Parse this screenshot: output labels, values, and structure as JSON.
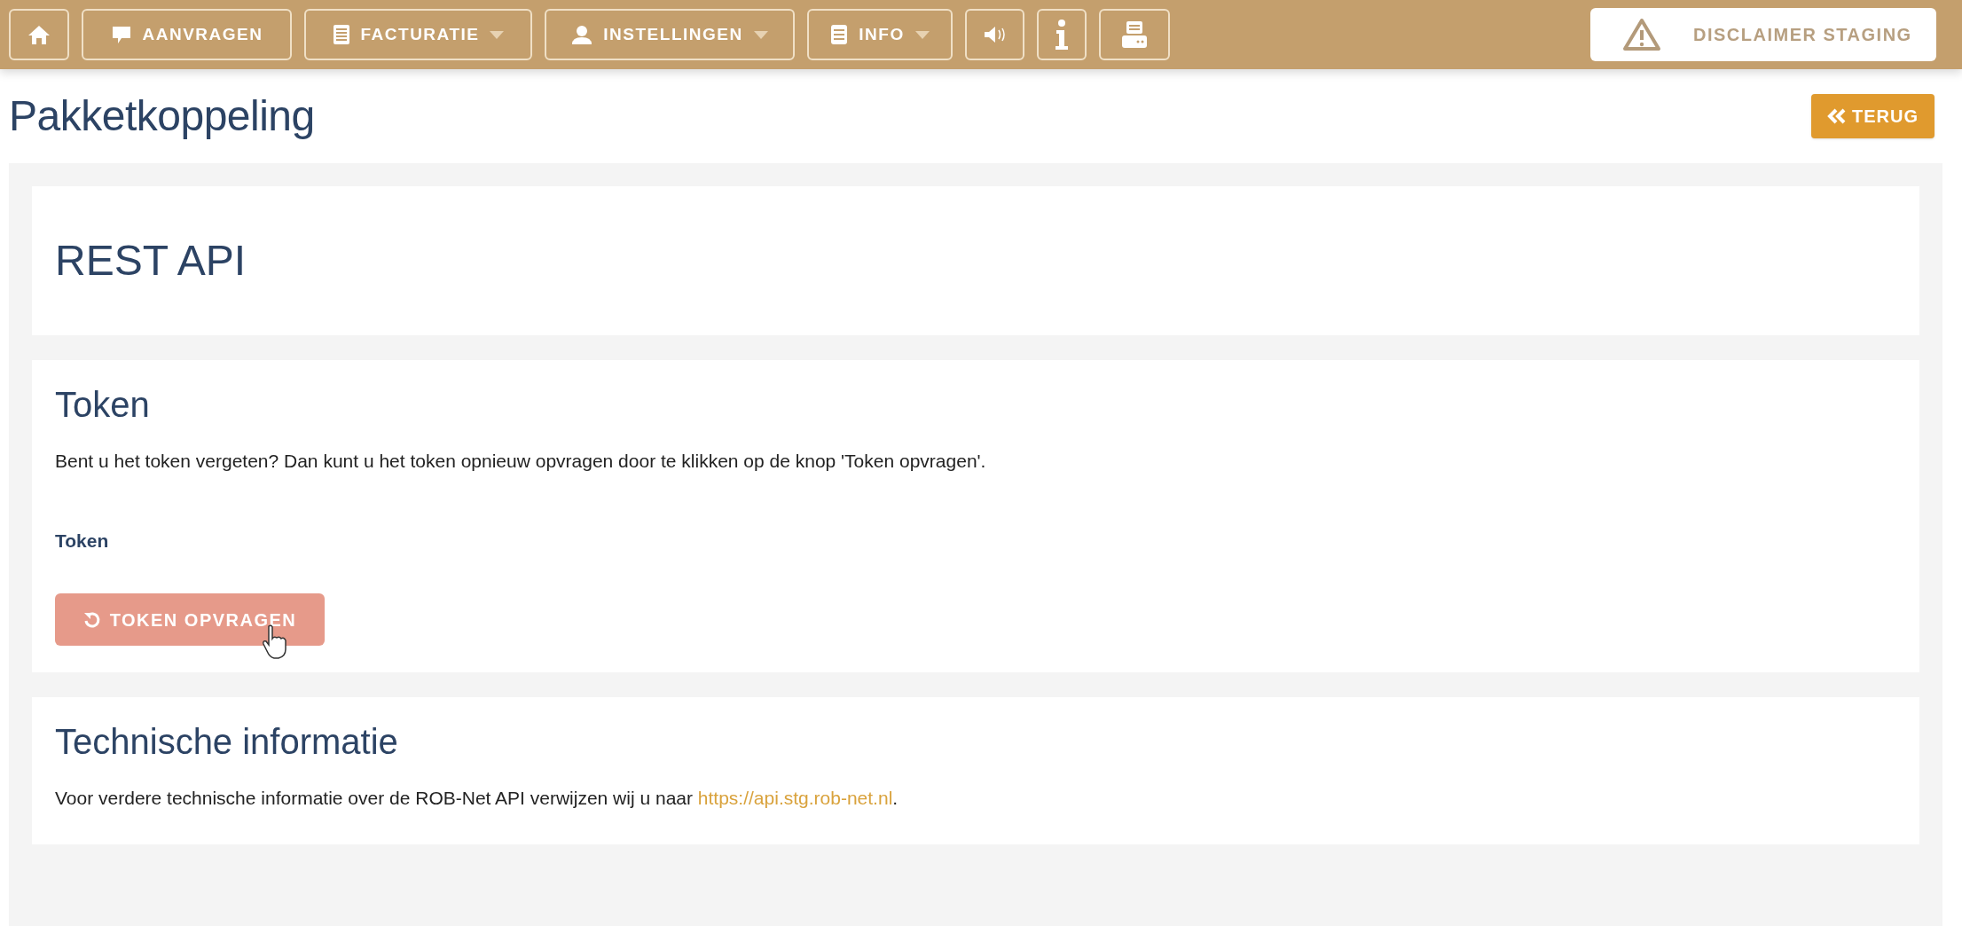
{
  "nav": [
    {
      "dropdown": false
    },
    {
      "label": "AANVRAGEN",
      "dropdown": false
    },
    {
      "label": "FACTURATIE",
      "dropdown": true
    },
    {
      "label": "INSTELLINGEN",
      "dropdown": true
    },
    {
      "label": "INFO",
      "dropdown": true
    },
    {
      "dropdown": false
    },
    {
      "dropdown": false
    },
    {
      "dropdown": false
    }
  ],
  "disclaimer": "DISCLAIMER STAGING",
  "page_title": "Pakketkoppeling",
  "back_button": "TERUG",
  "sections": [
    {
      "title": "REST API"
    },
    {
      "title": "Token",
      "text": "Bent u het token vergeten? Dan kunt u het token opnieuw opvragen door te klikken op de knop 'Token opvragen'.",
      "field_label": "Token",
      "button": "TOKEN OPVRAGEN"
    },
    {
      "title": "Technische informatie",
      "text": "Voor verdere technische informatie over de ROB-Net API verwijzen wij u naar",
      "link": "https://api.stg.rob-net.nl",
      "text_end": "."
    }
  ]
}
